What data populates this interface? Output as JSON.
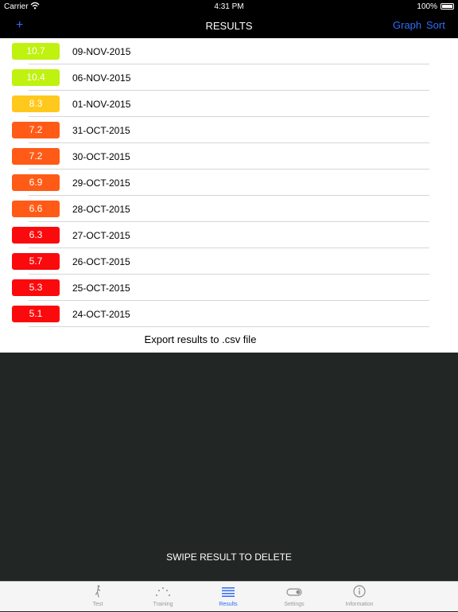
{
  "status_bar": {
    "carrier": "Carrier",
    "time": "4:31 PM",
    "battery": "100%"
  },
  "nav_bar": {
    "add_label": "+",
    "title": "RESULTS",
    "graph_label": "Graph",
    "sort_label": "Sort"
  },
  "results": [
    {
      "value": "10.7",
      "date": "09-NOV-2015",
      "color": "#bff20f"
    },
    {
      "value": "10.4",
      "date": "06-NOV-2015",
      "color": "#bff20f"
    },
    {
      "value": "8.3",
      "date": "01-NOV-2015",
      "color": "#ffc81c"
    },
    {
      "value": "7.2",
      "date": "31-OCT-2015",
      "color": "#ff5b17"
    },
    {
      "value": "7.2",
      "date": "30-OCT-2015",
      "color": "#ff5b17"
    },
    {
      "value": "6.9",
      "date": "29-OCT-2015",
      "color": "#ff5b17"
    },
    {
      "value": "6.6",
      "date": "28-OCT-2015",
      "color": "#ff5b17"
    },
    {
      "value": "6.3",
      "date": "27-OCT-2015",
      "color": "#fb0a0d"
    },
    {
      "value": "5.7",
      "date": "26-OCT-2015",
      "color": "#fb0a0d"
    },
    {
      "value": "5.3",
      "date": "25-OCT-2015",
      "color": "#fb0a0d"
    },
    {
      "value": "5.1",
      "date": "24-OCT-2015",
      "color": "#fb0a0d"
    }
  ],
  "export_label": "Export results to .csv file",
  "swipe_hint": "SWIPE RESULT TO DELETE",
  "tab_bar": {
    "tabs": [
      {
        "label": "Test",
        "icon": "runner-icon"
      },
      {
        "label": "Training",
        "icon": "dots-arc-icon"
      },
      {
        "label": "Results",
        "icon": "list-icon",
        "active": true
      },
      {
        "label": "Settings",
        "icon": "toggle-icon"
      },
      {
        "label": "Information",
        "icon": "info-icon"
      }
    ]
  },
  "colors": {
    "accent": "#2f6cf6",
    "background": "#222625"
  }
}
